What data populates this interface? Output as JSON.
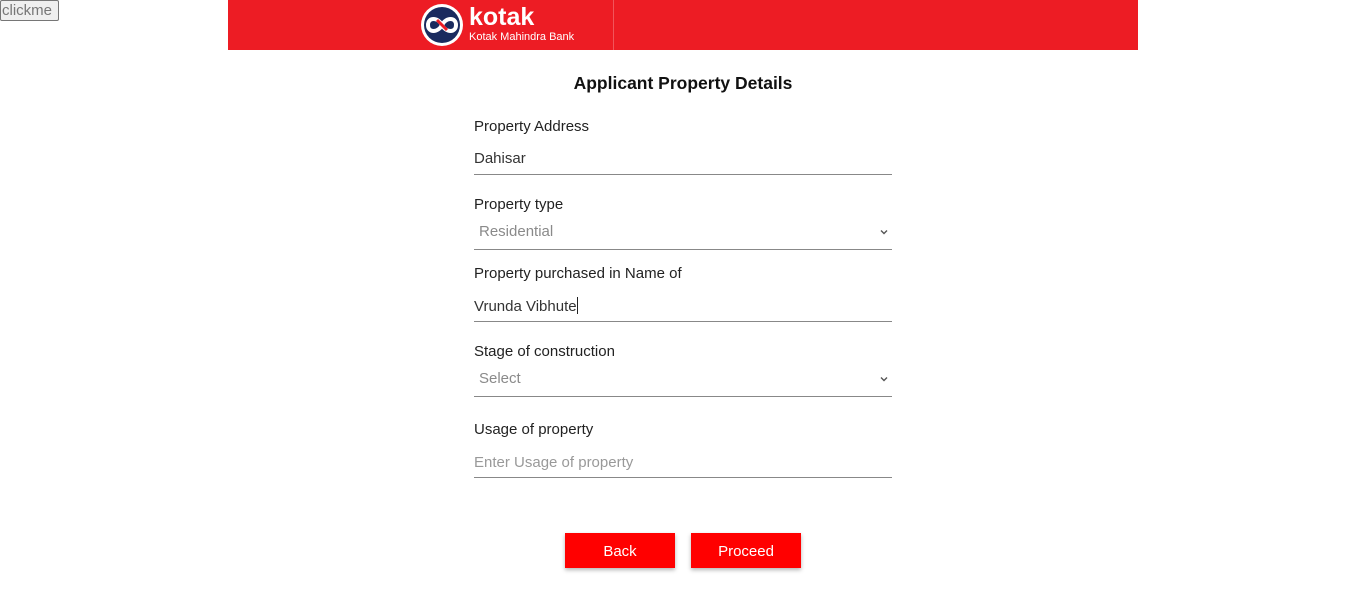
{
  "topbar": {
    "clickme_label": "clickme"
  },
  "brand": {
    "name": "kotak",
    "subtitle": "Kotak Mahindra Bank",
    "color": "#ed1c24",
    "logo_icon": "kotak-infinity-logo"
  },
  "form": {
    "title": "Applicant Property Details",
    "fields": {
      "address": {
        "label": "Property Address",
        "value": "Dahisar"
      },
      "type": {
        "label": "Property type",
        "selected": "Residential"
      },
      "purchased_name": {
        "label": "Property purchased in Name of",
        "value": "Vrunda Vibhute"
      },
      "stage": {
        "label": "Stage of construction",
        "selected": "Select"
      },
      "usage": {
        "label": "Usage of property",
        "placeholder": "Enter Usage of property",
        "value": ""
      }
    }
  },
  "buttons": {
    "back": "Back",
    "proceed": "Proceed",
    "color": "#ff0000"
  },
  "icons": {
    "dropdown": "chevron-down-icon"
  }
}
